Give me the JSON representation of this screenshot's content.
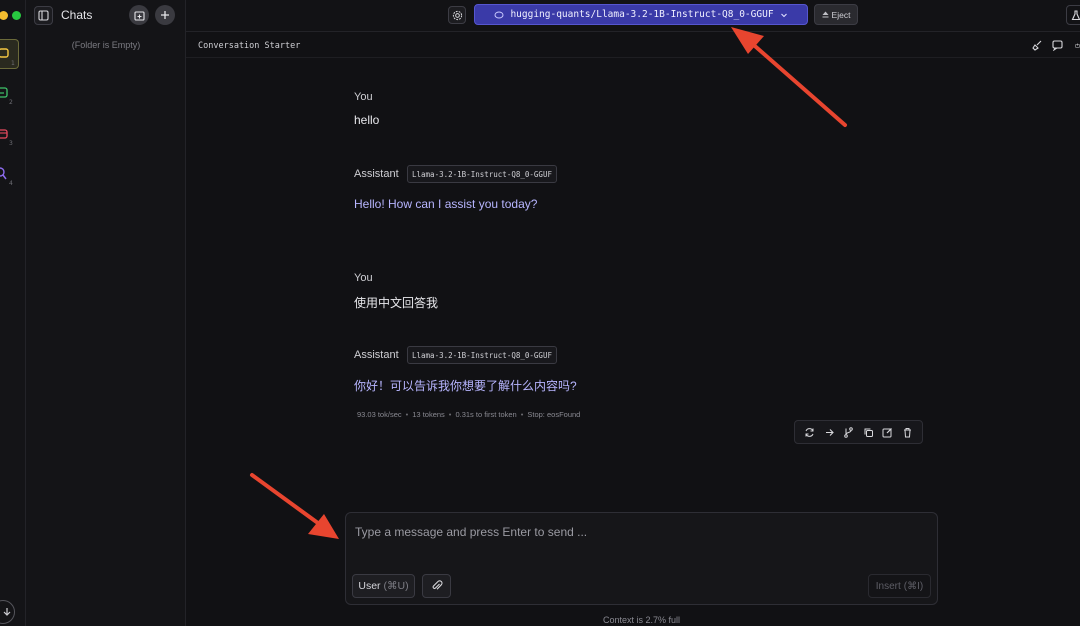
{
  "sidebar": {
    "title": "Chats",
    "empty_note": "(Folder is Empty)"
  },
  "rail": {
    "numbers": [
      "1",
      "2",
      "3",
      "4"
    ]
  },
  "topbar": {
    "model_name": "hugging-quants/Llama-3.2-1B-Instruct-Q8_0-GGUF",
    "eject_label": "Eject"
  },
  "conversation": {
    "title": "Conversation Starter",
    "messages": [
      {
        "role": "You",
        "text": "hello"
      },
      {
        "role": "Assistant",
        "model": "Llama-3.2-1B-Instruct-Q8_0-GGUF",
        "text": "Hello! How can I assist you today?"
      },
      {
        "role": "You",
        "text": "使用中文回答我"
      },
      {
        "role": "Assistant",
        "model": "Llama-3.2-1B-Instruct-Q8_0-GGUF",
        "text": "你好！可以告诉我你想要了解什么内容吗?"
      }
    ],
    "stats": {
      "speed": "93.03 tok/sec",
      "tokens": "13 tokens",
      "first_token": "0.31s to first token",
      "stop": "Stop: eosFound"
    }
  },
  "composer": {
    "placeholder": "Type a message and press Enter to send ...",
    "user_label": "User",
    "user_shortcut": "(⌘U)",
    "insert_label": "Insert",
    "insert_shortcut": "(⌘I)",
    "context_note": "Context is 2.7% full"
  },
  "colors": {
    "accent": "#3a3aa8",
    "assistant_text": "#b7b5ff",
    "annotation_arrow": "#e8452f"
  }
}
